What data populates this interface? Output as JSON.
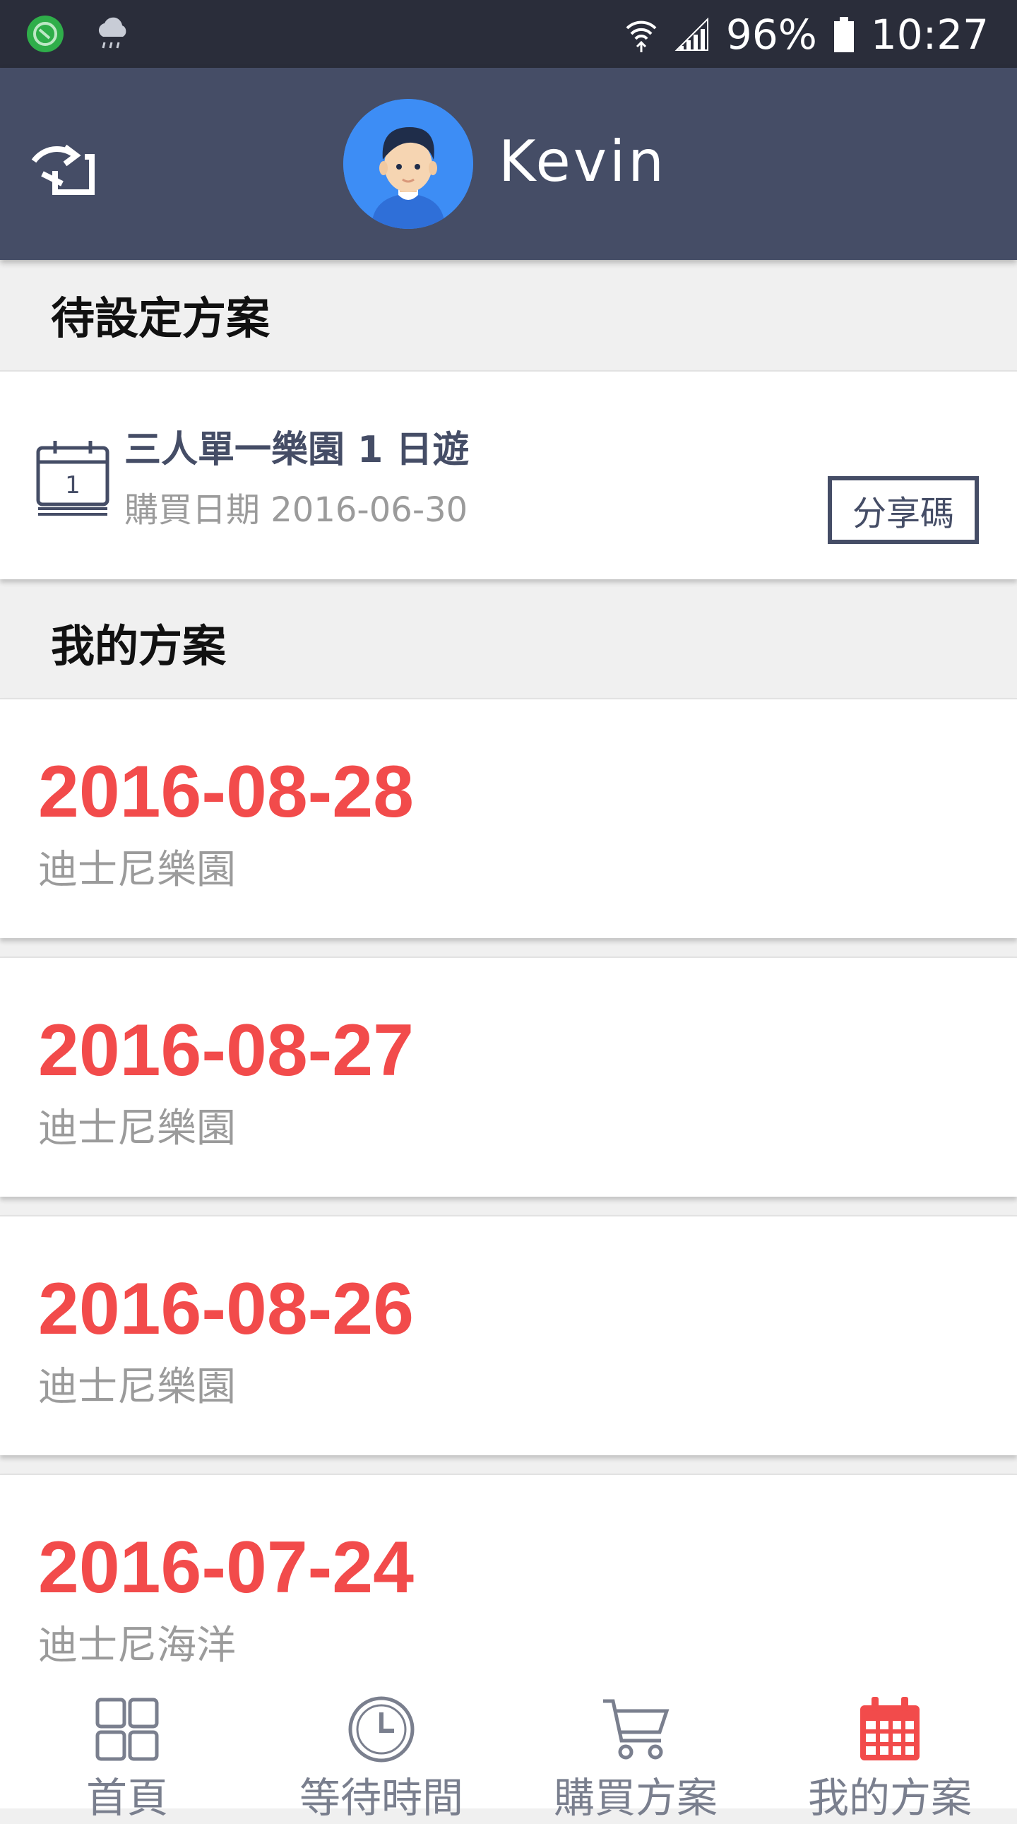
{
  "status_bar": {
    "battery": "96%",
    "time": "10:27"
  },
  "header": {
    "username": "Kevin"
  },
  "pending_section": {
    "title": "待設定方案",
    "item": {
      "title": "三人單一樂園 1 日遊",
      "purchase_date": "購買日期 2016-06-30",
      "share_label": "分享碼",
      "calendar_day": "1"
    }
  },
  "my_plans_section": {
    "title": "我的方案",
    "plans": [
      {
        "date": "2016-08-28",
        "place": "迪士尼樂園"
      },
      {
        "date": "2016-08-27",
        "place": "迪士尼樂園"
      },
      {
        "date": "2016-08-26",
        "place": "迪士尼樂園"
      },
      {
        "date": "2016-07-24",
        "place": "迪士尼海洋"
      }
    ]
  },
  "tabbar": {
    "items": [
      {
        "label": "首頁",
        "icon": "grid-icon"
      },
      {
        "label": "等待時間",
        "icon": "clock-icon"
      },
      {
        "label": "購買方案",
        "icon": "cart-icon"
      },
      {
        "label": "我的方案",
        "icon": "calendar-icon"
      }
    ],
    "active_color": "#f24b4b",
    "inactive_color": "#7a7f8e"
  }
}
